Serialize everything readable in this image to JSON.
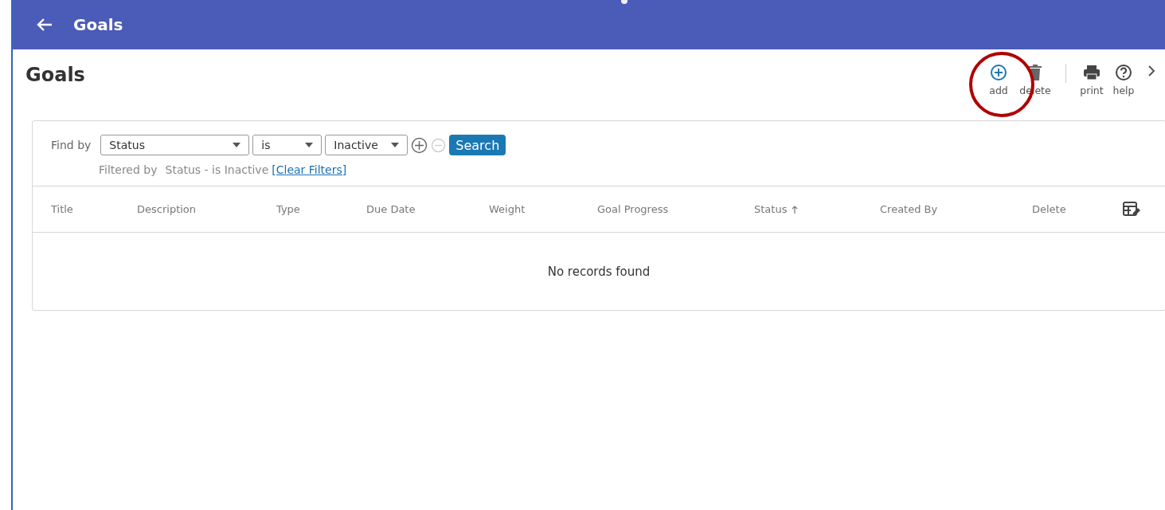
{
  "header": {
    "title": "Goals"
  },
  "page": {
    "title": "Goals"
  },
  "toolbar": [
    {
      "label": "add",
      "kind": "add",
      "highlighted": true
    },
    {
      "label": "delete",
      "kind": "delete",
      "highlighted": false
    },
    {
      "label": "print",
      "kind": "print",
      "highlighted": false
    },
    {
      "label": "help",
      "kind": "help",
      "highlighted": false
    }
  ],
  "filter": {
    "label": "Find by",
    "field": "Status",
    "operator": "is",
    "value": "Inactive",
    "search_button": "Search",
    "filtered_by_label": "Filtered by",
    "filtered_by_value": "Status - is Inactive",
    "clear_link": "[Clear Filters]"
  },
  "table": {
    "columns": [
      {
        "label": "Title",
        "sorted": false
      },
      {
        "label": "Description",
        "sorted": false
      },
      {
        "label": "Type",
        "sorted": false
      },
      {
        "label": "Due Date",
        "sorted": false
      },
      {
        "label": "Weight",
        "sorted": false
      },
      {
        "label": "Goal Progress",
        "sorted": false
      },
      {
        "label": "Status",
        "sorted": true
      },
      {
        "label": "Created By",
        "sorted": false
      },
      {
        "label": "Delete",
        "sorted": false
      }
    ],
    "empty_message": "No records found"
  }
}
